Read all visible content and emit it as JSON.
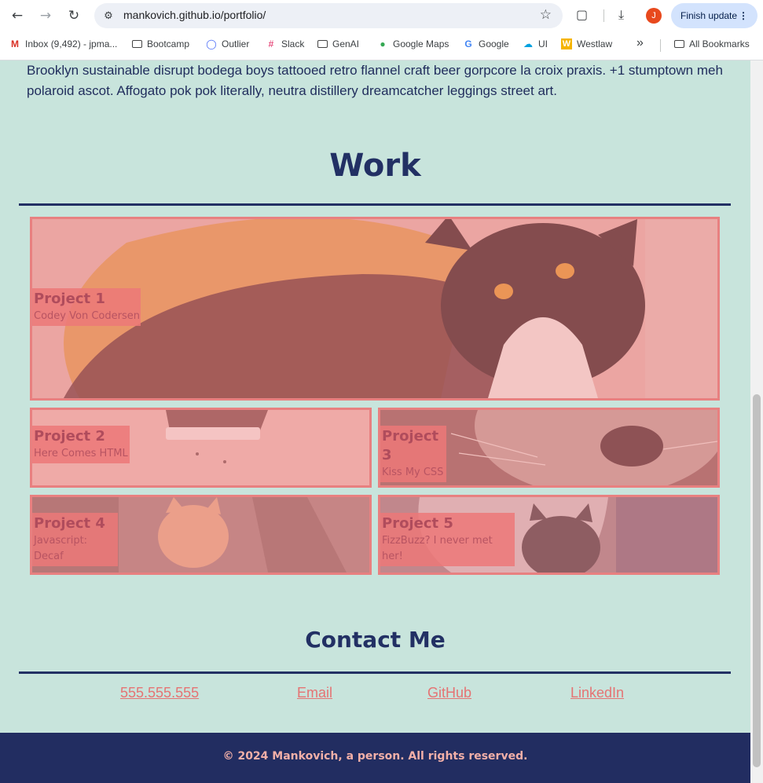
{
  "browser": {
    "url": "mankovich.github.io/portfolio/",
    "update_button": "Finish update",
    "avatar_letter": "J"
  },
  "bookmarks": [
    {
      "label": "Inbox (9,492) - jpma...",
      "icon": "gmail-icon"
    },
    {
      "label": "Bootcamp",
      "icon": "folder-icon"
    },
    {
      "label": "Outlier",
      "icon": "outlier-icon"
    },
    {
      "label": "Slack",
      "icon": "slack-icon"
    },
    {
      "label": "GenAI",
      "icon": "folder-icon"
    },
    {
      "label": "Google Maps",
      "icon": "maps-icon"
    },
    {
      "label": "Google",
      "icon": "google-icon"
    },
    {
      "label": "UI",
      "icon": "salesforce-icon"
    },
    {
      "label": "Westlaw",
      "icon": "westlaw-icon"
    }
  ],
  "bookmarks_more": "»",
  "all_bookmarks": "All Bookmarks",
  "intro_text": "Brooklyn sustainable disrupt bodega boys tattooed retro flannel craft beer gorpcore la croix praxis. +1 stumptown meh polaroid ascot. Affogato pok pok literally, neutra distillery dreamcatcher leggings street art.",
  "work": {
    "title": "Work",
    "projects": [
      {
        "name": "Project 1",
        "desc": "Codey Von Codersen"
      },
      {
        "name": "Project 2",
        "desc": "Here Comes HTML"
      },
      {
        "name": "Project 3",
        "desc": "Kiss My CSS"
      },
      {
        "name": "Project 4",
        "desc": "Javascript: Decaf"
      },
      {
        "name": "Project 5",
        "desc": "FizzBuzz? I never met her!"
      }
    ]
  },
  "contact": {
    "title": "Contact Me",
    "links": [
      "555.555.555",
      "Email",
      "GitHub",
      "LinkedIn"
    ]
  },
  "footer": {
    "text": "© 2024 Mankovich, a person. All rights reserved."
  },
  "colors": {
    "page_bg": "#c8e4dc",
    "navy": "#223064",
    "accent": "#e88080"
  }
}
